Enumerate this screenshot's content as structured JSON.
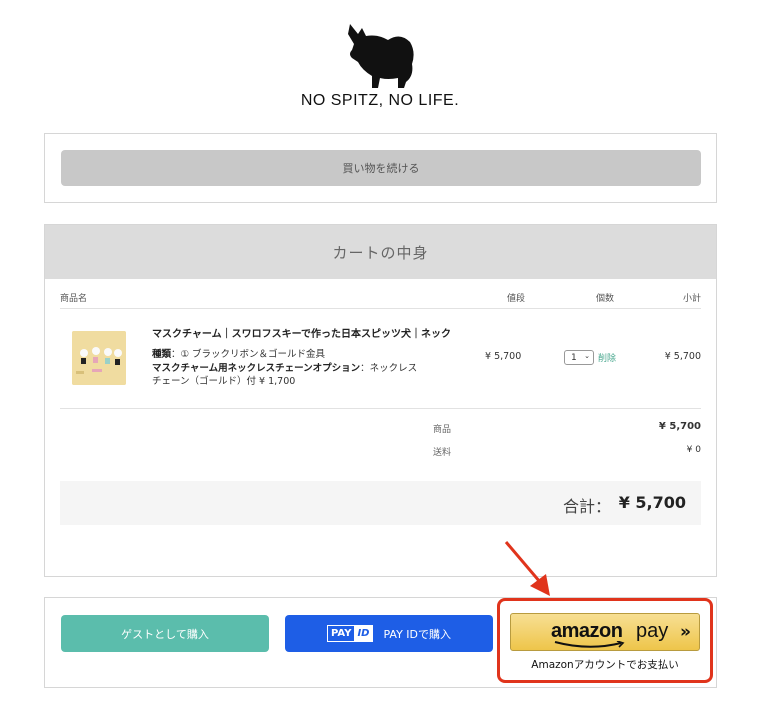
{
  "logo": {
    "text": "NO SPITZ, NO LIFE."
  },
  "continue_button": "買い物を続ける",
  "cart": {
    "title": "カートの中身",
    "columns": {
      "product": "商品名",
      "price": "値段",
      "qty": "個数",
      "subtotal": "小計"
    },
    "item": {
      "name": "マスクチャーム｜スワロフスキーで作った日本スピッツ犬｜ネック",
      "option1_label": "種類",
      "option1_value": "：① ブラックリボン＆ゴールド金具",
      "option2_label": "マスクチャーム用ネックレスチェーンオプション",
      "option2_value": "：ネックレス",
      "option2_cont": "チェーン（ゴールド）付 ¥ 1,700",
      "price": "¥ 5,700",
      "qty": "1",
      "delete_label": "削除",
      "subtotal": "¥ 5,700"
    },
    "summary": {
      "goods_label": "商品",
      "goods_value": "¥ 5,700",
      "shipping_label": "送料",
      "shipping_value": "¥ 0",
      "total_label": "合計：",
      "total_value": "¥ 5,700"
    }
  },
  "checkout": {
    "guest_button": "ゲストとして購入",
    "payid_logo_left": "PAY",
    "payid_logo_right": "ID",
    "payid_button": "PAY IDで購入",
    "amazon_word": "amazon",
    "amazon_pay": "pay",
    "amazon_chevron": "»",
    "amazon_note": "Amazonアカウントでお支払い"
  },
  "colors": {
    "accent_green": "#5bbdac",
    "payid_blue": "#1e5ee6",
    "highlight_red": "#e0341c",
    "amazon_gold": "#eec54a"
  }
}
